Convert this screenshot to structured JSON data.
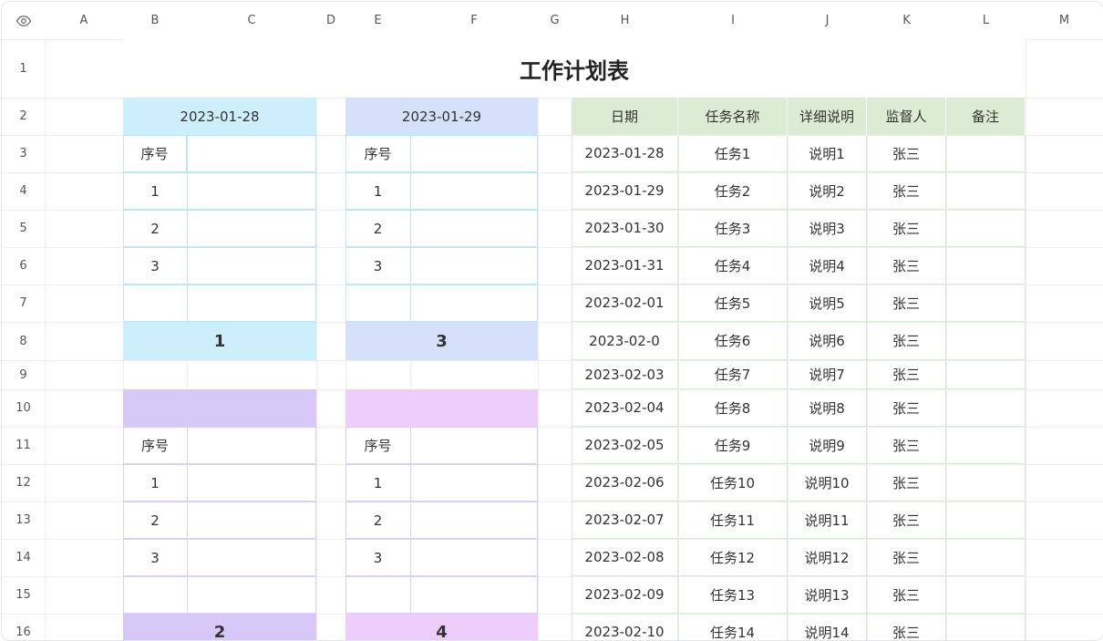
{
  "columns": [
    "A",
    "B",
    "C",
    "D",
    "E",
    "F",
    "G",
    "H",
    "I",
    "J",
    "K",
    "L",
    "M"
  ],
  "rows": [
    "1",
    "2",
    "3",
    "4",
    "5",
    "6",
    "7",
    "8",
    "9",
    "10",
    "11",
    "12",
    "13",
    "14",
    "15",
    "16"
  ],
  "title": "工作计划表",
  "block1": {
    "date": "2023-01-28",
    "seq": "序号",
    "n1": "1",
    "n2": "2",
    "n3": "3",
    "total": "1"
  },
  "block2": {
    "date": "2023-01-29",
    "seq": "序号",
    "n1": "1",
    "n2": "2",
    "n3": "3",
    "total": "3"
  },
  "block3": {
    "seq": "序号",
    "n1": "1",
    "n2": "2",
    "n3": "3",
    "total": "2"
  },
  "block4": {
    "seq": "序号",
    "n1": "1",
    "n2": "2",
    "n3": "3",
    "total": "4"
  },
  "tasks_header": {
    "date": "日期",
    "name": "任务名称",
    "detail": "详细说明",
    "supervisor": "监督人",
    "note": "备注"
  },
  "tasks": [
    {
      "date": "2023-01-28",
      "name": "任务1",
      "detail": "说明1",
      "supervisor": "张三"
    },
    {
      "date": "2023-01-29",
      "name": "任务2",
      "detail": "说明2",
      "supervisor": "张三"
    },
    {
      "date": "2023-01-30",
      "name": "任务3",
      "detail": "说明3",
      "supervisor": "张三"
    },
    {
      "date": "2023-01-31",
      "name": "任务4",
      "detail": "说明4",
      "supervisor": "张三"
    },
    {
      "date": "2023-02-01",
      "name": "任务5",
      "detail": "说明5",
      "supervisor": "张三"
    },
    {
      "date": "2023-02-0",
      "name": "任务6",
      "detail": "说明6",
      "supervisor": "张三"
    },
    {
      "date": "2023-02-03",
      "name": "任务7",
      "detail": "说明7",
      "supervisor": "张三"
    },
    {
      "date": "2023-02-04",
      "name": "任务8",
      "detail": "说明8",
      "supervisor": "张三"
    },
    {
      "date": "2023-02-05",
      "name": "任务9",
      "detail": "说明9",
      "supervisor": "张三"
    },
    {
      "date": "2023-02-06",
      "name": "任务10",
      "detail": "说明10",
      "supervisor": "张三"
    },
    {
      "date": "2023-02-07",
      "name": "任务11",
      "detail": "说明11",
      "supervisor": "张三"
    },
    {
      "date": "2023-02-08",
      "name": "任务12",
      "detail": "说明12",
      "supervisor": "张三"
    },
    {
      "date": "2023-02-09",
      "name": "任务13",
      "detail": "说明13",
      "supervisor": "张三"
    },
    {
      "date": "2023-02-10",
      "name": "任务14",
      "detail": "说明14",
      "supervisor": "张三"
    }
  ],
  "colors": {
    "block1_fill": "#cdeefb",
    "block2_fill": "#d5e1fb",
    "block3_fill": "#d7c8f8",
    "block4_fill": "#efcdfb",
    "tasks_header_fill": "#dcebd3",
    "block1_border": "#bfe6f5",
    "block3_border": "#dccff5",
    "tasks_border": "#d8ecd0"
  },
  "icons": {
    "corner": "eye-icon"
  }
}
